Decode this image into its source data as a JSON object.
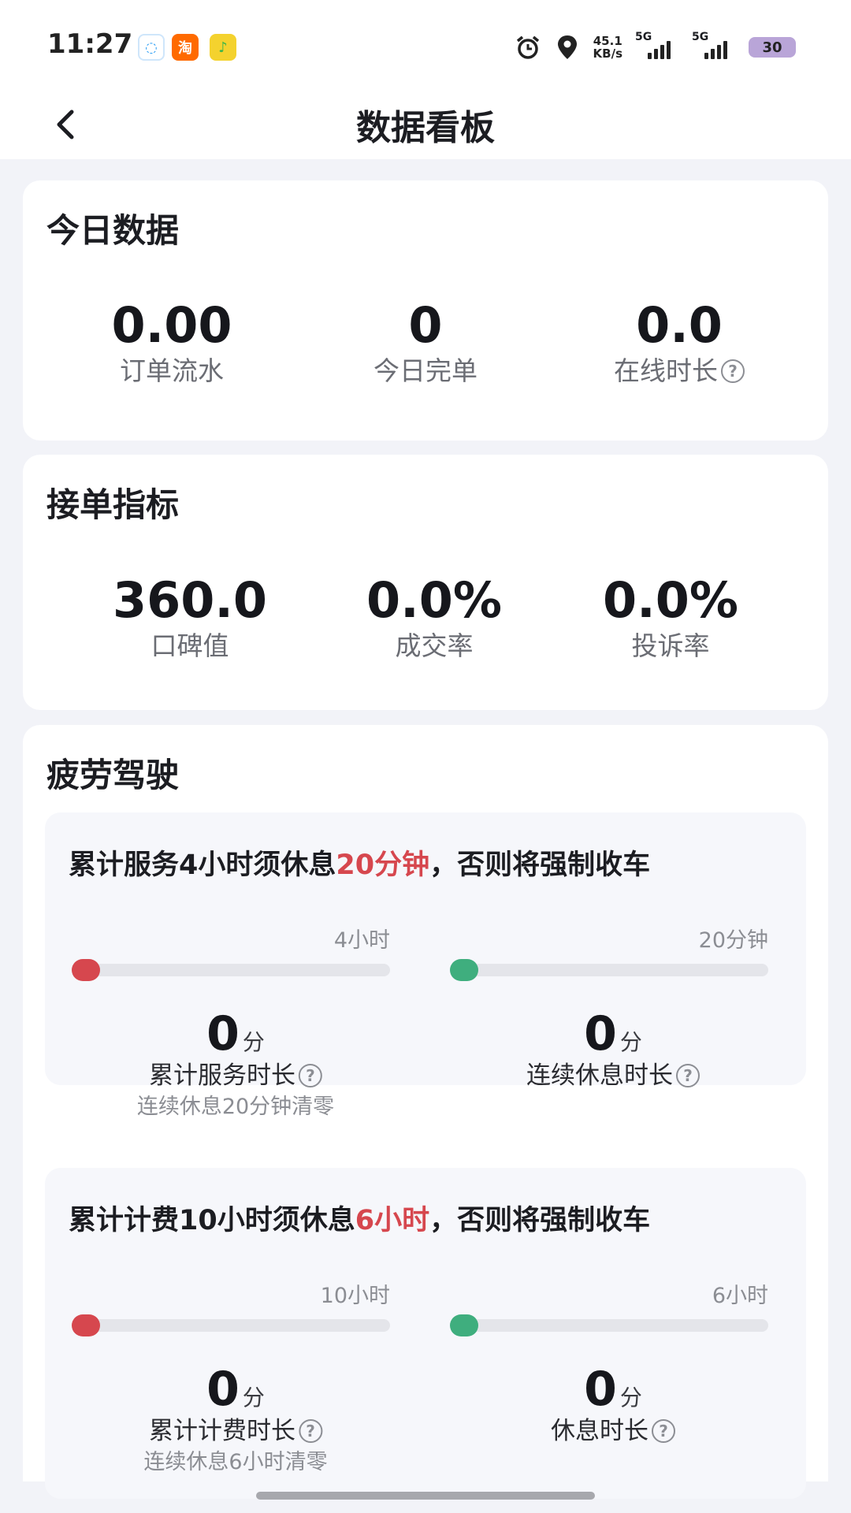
{
  "status_bar": {
    "time": "11:27",
    "apps": [
      {
        "name": "messenger-icon",
        "glyph": "◌",
        "color": "#2a9df4"
      },
      {
        "name": "taobao-icon",
        "glyph": "淘",
        "color": "#ff6a00"
      },
      {
        "name": "music-icon",
        "glyph": "♪",
        "color": "#3cb64a"
      }
    ],
    "net_speed_value": "45.1",
    "net_speed_unit": "KB/s",
    "signal1_label": "5G",
    "signal2_label": "5G",
    "battery": "30"
  },
  "header": {
    "title": "数据看板"
  },
  "today": {
    "title": "今日数据",
    "stats": [
      {
        "value": "0.00",
        "label": "订单流水"
      },
      {
        "value": "0",
        "label": "今日完单"
      },
      {
        "value": "0.0",
        "label": "在线时长"
      }
    ]
  },
  "order_metrics": {
    "title": "接单指标",
    "stats": [
      {
        "value": "360.0",
        "label": "口碑值"
      },
      {
        "value": "0.0%",
        "label": "成交率"
      },
      {
        "value": "0.0%",
        "label": "投诉率"
      }
    ]
  },
  "fatigue": {
    "title": "疲劳驾驶",
    "colors": {
      "red": "#d6474e",
      "green": "#3fae7e"
    },
    "rules": [
      {
        "text_before": "累计服务4小时须休息",
        "text_highlight": "20分钟",
        "text_after": "，否则将强制收车",
        "left_bar_max": "4小时",
        "right_bar_max": "20分钟",
        "left_progress": 0,
        "right_progress": 0,
        "left_value": "0",
        "left_unit": "分",
        "left_name": "累计服务时长",
        "left_note": "连续休息20分钟清零",
        "right_value": "0",
        "right_unit": "分",
        "right_name": "连续休息时长"
      },
      {
        "text_before": "累计计费10小时须休息",
        "text_highlight": "6小时",
        "text_after": "，否则将强制收车",
        "left_bar_max": "10小时",
        "right_bar_max": "6小时",
        "left_progress": 0,
        "right_progress": 0,
        "left_value": "0",
        "left_unit": "分",
        "left_name": "累计计费时长",
        "left_note": "连续休息6小时清零",
        "right_value": "0",
        "right_unit": "分",
        "right_name": "休息时长"
      }
    ]
  },
  "help_glyph": "?"
}
